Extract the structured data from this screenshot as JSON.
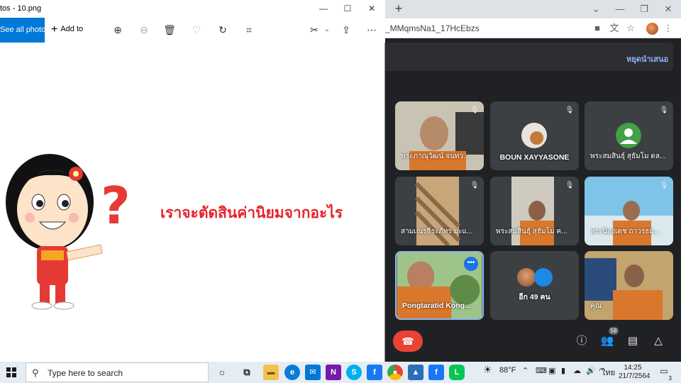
{
  "photos": {
    "title": "tos - 10.png",
    "see_all": "See all photos",
    "add_to": "Add to",
    "image_text": "เราจะตัดสินค่านิยมจากอะไร"
  },
  "chrome": {
    "url": "_MMqmsNa1_17HcEbzs"
  },
  "meet": {
    "stop_presenting": "หยุดนำเสนอ",
    "participant_badge": "58",
    "tiles": [
      {
        "name": "พระภาณุวัฒน์ จนทว..."
      },
      {
        "name": "BOUN XAYYASONE"
      },
      {
        "name": "พระสมสินธุ์ สุธัมโม ดล..."
      },
      {
        "name": "สามเณรธีระภัทร มะแ..."
      },
      {
        "name": "พระสมสินธุ์ สุธัมโม ค..."
      },
      {
        "name": "พระน้องเดช ถาวรธม..."
      },
      {
        "name": "Pongtaratid Kong..."
      },
      {
        "name": "อีก 49 คน"
      },
      {
        "name": "คุณ"
      }
    ]
  },
  "taskbar": {
    "search_placeholder": "Type here to search",
    "weather": "88°F",
    "language": "ไทย",
    "time": "14:25",
    "date": "21/7/2564",
    "notifications": "3"
  }
}
